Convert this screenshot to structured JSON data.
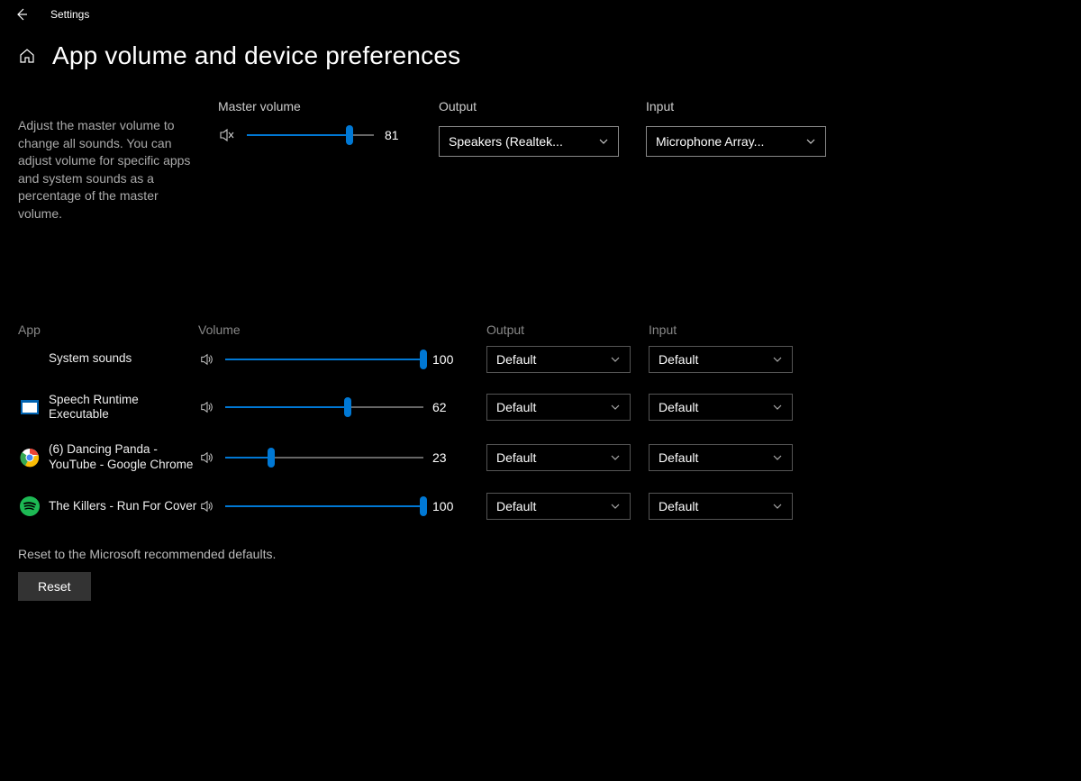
{
  "window": {
    "title": "Settings"
  },
  "page": {
    "title": "App volume and device preferences",
    "description": "Adjust the master volume to change all sounds. You can adjust volume for specific apps and system sounds as a percentage of the master volume."
  },
  "master": {
    "volume_label": "Master volume",
    "volume_value": "81",
    "volume_percent": 81,
    "output_label": "Output",
    "output_value": "Speakers (Realtek...",
    "input_label": "Input",
    "input_value": "Microphone Array..."
  },
  "columns": {
    "app": "App",
    "volume": "Volume",
    "output": "Output",
    "input": "Input"
  },
  "apps": [
    {
      "name": "System sounds",
      "icon": "none",
      "volume_value": "100",
      "volume_percent": 100,
      "output": "Default",
      "input": "Default"
    },
    {
      "name": "Speech Runtime Executable",
      "icon": "window",
      "volume_value": "62",
      "volume_percent": 62,
      "output": "Default",
      "input": "Default"
    },
    {
      "name": "(6) Dancing Panda - YouTube - Google Chrome",
      "icon": "chrome",
      "volume_value": "23",
      "volume_percent": 23,
      "output": "Default",
      "input": "Default"
    },
    {
      "name": "The Killers - Run For Cover",
      "icon": "spotify",
      "volume_value": "100",
      "volume_percent": 100,
      "output": "Default",
      "input": "Default"
    }
  ],
  "reset": {
    "text": "Reset to the Microsoft recommended defaults.",
    "button": "Reset"
  }
}
